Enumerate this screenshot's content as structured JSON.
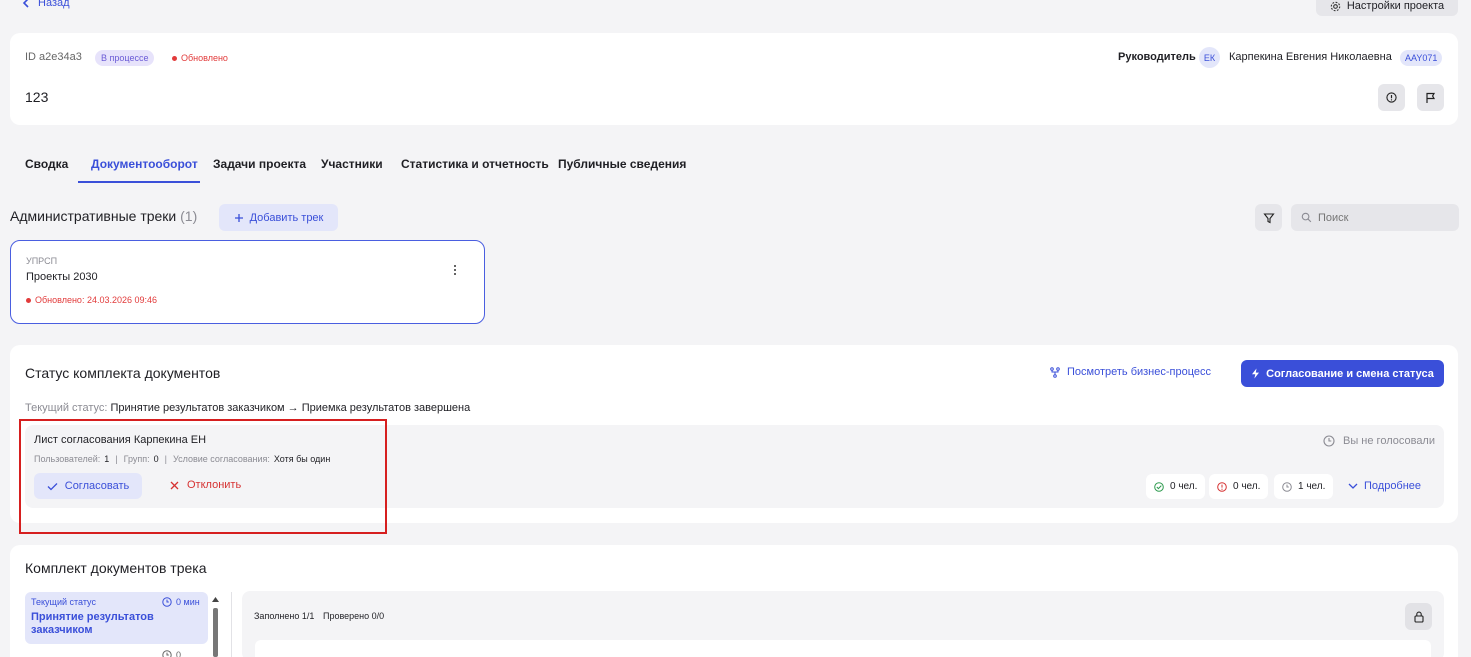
{
  "nav": {
    "back_label": "Назад",
    "settings_label": "Настройки проекта"
  },
  "project": {
    "id": "ID a2e34a3",
    "status_badge": "В процессе",
    "updated_label": "Обновлено",
    "name": "123",
    "manager_label": "Руководитель",
    "manager_initials": "ЕК",
    "manager_name": "Карпекина Евгения Николаевна",
    "manager_code": "AAY071"
  },
  "tabs": [
    {
      "label": "Сводка",
      "active": false
    },
    {
      "label": "Документооборот",
      "active": true
    },
    {
      "label": "Задачи проекта",
      "active": false
    },
    {
      "label": "Участники",
      "active": false
    },
    {
      "label": "Статистика и отчетность",
      "active": false
    },
    {
      "label": "Публичные сведения",
      "active": false
    }
  ],
  "tracks": {
    "title": "Административные треки",
    "count": "(1)",
    "add_label": "Добавить трек",
    "search_placeholder": "Поиск",
    "items": [
      {
        "org": "УПРСП",
        "name": "Проекты 2030",
        "updated": "Обновлено: 24.03.2026 09:46"
      }
    ]
  },
  "status": {
    "title": "Статус комплекта документов",
    "view_process_label": "Посмотреть бизнес-процесс",
    "approve_change_label": "Согласование и смена статуса",
    "current_prefix": "Текущий статус:",
    "current_value": "Принятие результатов заказчиком → Приемка результатов завершена",
    "sheet": {
      "title": "Лист согласования Карпекина ЕН",
      "users_label": "Пользователей:",
      "users_value": "1",
      "groups_label": "Групп:",
      "groups_value": "0",
      "condition_label": "Условие согласования:",
      "condition_value": "Хотя бы один",
      "approve_label": "Согласовать",
      "reject_label": "Отклонить",
      "vote_status": "Вы не голосовали",
      "approved_count": "0 чел.",
      "rejected_count": "0 чел.",
      "pending_count": "1 чел.",
      "more_label": "Подробнее"
    }
  },
  "docset": {
    "title": "Комплект документов трека",
    "current_status_label": "Текущий статус",
    "current_time": "0 мин",
    "current_status_value": "Принятие результатов заказчиком",
    "next_time": "0",
    "filled_label": "Заполнено 1/1",
    "checked_label": "Проверено 0/0"
  },
  "colors": {
    "accent": "#3a4fd9",
    "highlight_border": "#d61f1f",
    "danger": "#d63232",
    "success": "#2e9b4f"
  }
}
